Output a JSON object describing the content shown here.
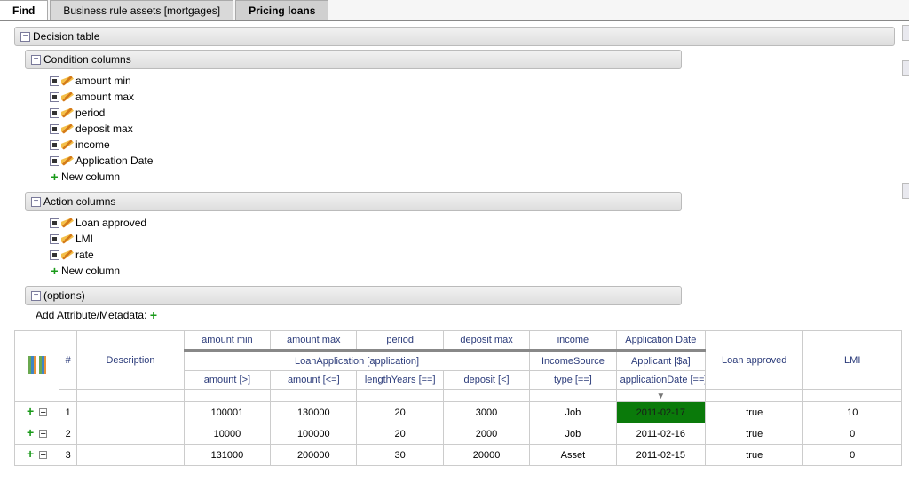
{
  "tabs": {
    "find": "Find",
    "assets": "Business rule assets [mortgages]",
    "pricing": "Pricing loans"
  },
  "panels": {
    "decision_table": "Decision table",
    "condition_cols": "Condition columns",
    "action_cols": "Action columns",
    "options": "(options)"
  },
  "condition_items": [
    "amount min",
    "amount max",
    "period",
    "deposit max",
    "income",
    "Application Date"
  ],
  "action_items": [
    "Loan approved",
    "LMI",
    "rate"
  ],
  "new_column": "New column",
  "add_attr": "Add Attribute/Metadata:",
  "headers": {
    "hash": "#",
    "desc": "Description",
    "cond_labels": [
      "amount min",
      "amount max",
      "period",
      "deposit max",
      "income",
      "Application Date"
    ],
    "loan_app": "LoanApplication [application]",
    "income_src": "IncomeSource",
    "applicant": "Applicant [$a]",
    "subs": [
      "amount [>]",
      "amount [<=]",
      "lengthYears [==]",
      "deposit [<]",
      "type [==]",
      "applicationDate [==]"
    ],
    "approved": "Loan approved",
    "lmi": "LMI"
  },
  "rows": [
    {
      "n": "1",
      "desc": "",
      "amount_min": "100001",
      "amount_max": "130000",
      "period": "20",
      "deposit": "3000",
      "income": "Job",
      "date": "2011-02-17",
      "approved": "true",
      "lmi": "10",
      "highlight": true
    },
    {
      "n": "2",
      "desc": "",
      "amount_min": "10000",
      "amount_max": "100000",
      "period": "20",
      "deposit": "2000",
      "income": "Job",
      "date": "2011-02-16",
      "approved": "true",
      "lmi": "0",
      "highlight": false
    },
    {
      "n": "3",
      "desc": "",
      "amount_min": "131000",
      "amount_max": "200000",
      "period": "30",
      "deposit": "20000",
      "income": "Asset",
      "date": "2011-02-15",
      "approved": "true",
      "lmi": "0",
      "highlight": false
    }
  ]
}
